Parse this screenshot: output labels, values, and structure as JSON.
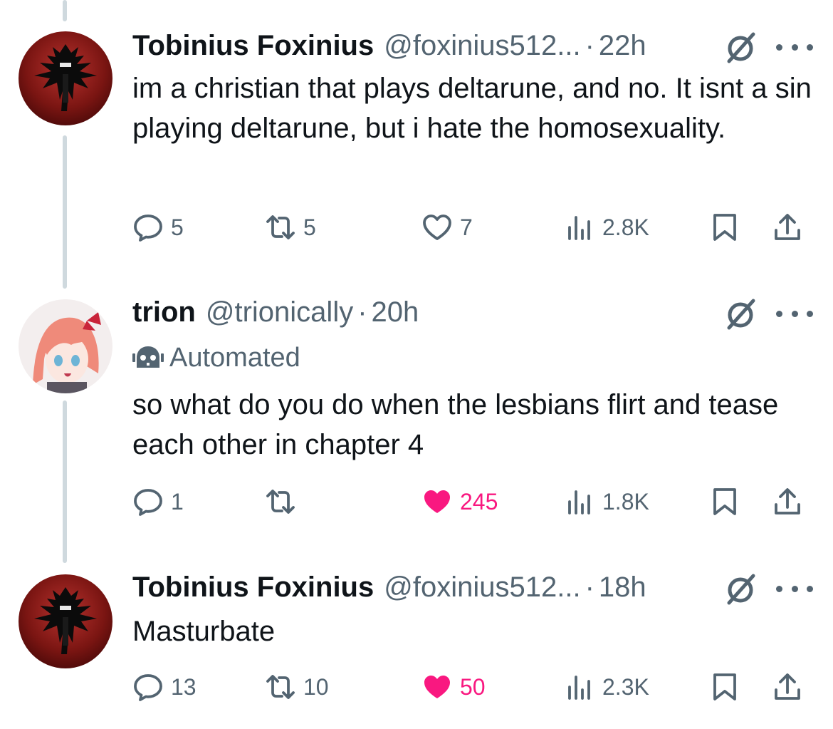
{
  "tweets": [
    {
      "name": "Tobinius Foxinius",
      "handle": "@foxinius512...",
      "dot": "·",
      "time": "22h",
      "text": "im a christian that plays deltarune, and no. It isnt a sin playing deltarune, but i hate the homosexuality.",
      "replies": "5",
      "reposts": "5",
      "likes": "7",
      "liked": false,
      "views": "2.8K",
      "avatar": "demon-silhouette-red"
    },
    {
      "name": "trion",
      "handle": "@trionically",
      "dot": "·",
      "time": "20h",
      "automated_label": "Automated",
      "text": "so what do you do when the lesbians flirt and tease each other in chapter 4",
      "replies": "1",
      "reposts": "",
      "likes": "245",
      "liked": true,
      "views": "1.8K",
      "avatar": "anime-girl-pink-hair"
    },
    {
      "name": "Tobinius Foxinius",
      "handle": "@foxinius512...",
      "dot": "·",
      "time": "18h",
      "text": "Masturbate",
      "replies": "13",
      "reposts": "10",
      "likes": "50",
      "liked": true,
      "views": "2.3K",
      "avatar": "demon-silhouette-red"
    }
  ],
  "colors": {
    "text": "#0f1419",
    "muted": "#536471",
    "like": "#f91880",
    "thread_line": "#cfd9de"
  }
}
